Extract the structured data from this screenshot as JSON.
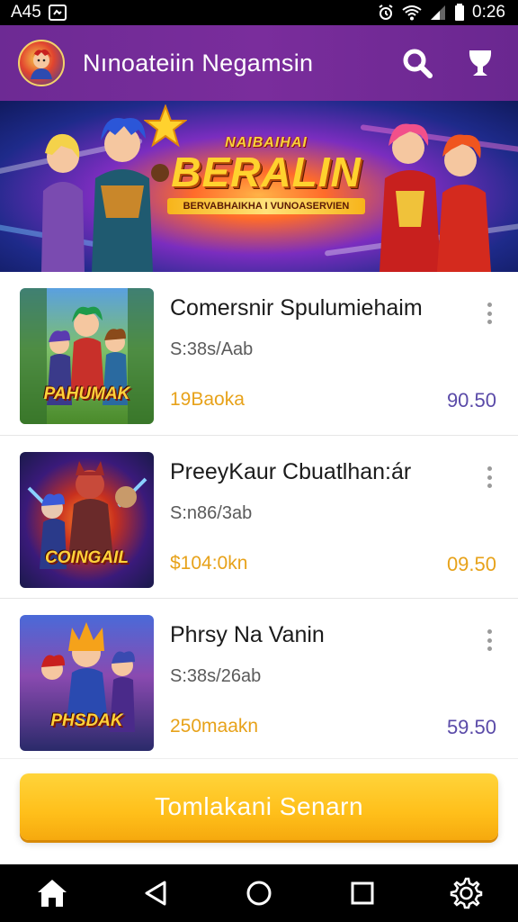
{
  "status_bar": {
    "left_text": "A45",
    "time": "0:26"
  },
  "header": {
    "title": "Nınoateiin  Negamsin",
    "search_icon": "search-icon",
    "trophy_icon": "trophy-icon"
  },
  "banner": {
    "subtitle": "NAIBAIHAI",
    "title": "BERALIN",
    "ribbon": "BERVABHAIKHA I VUNOASERVIEN"
  },
  "games": [
    {
      "name": "Comersnir Spulumiehaim",
      "sub": "S:38s/Aab",
      "price": "19Baoka",
      "rate": "90.50",
      "thumb_label": "PAHUMAK",
      "rate_color": "#5a4aa8"
    },
    {
      "name": "PreeyKaur Cbuatlhan:ár",
      "sub": "S:n86/3ab",
      "price": "$104:0kn",
      "rate": "09.50",
      "thumb_label": "COINGAIL",
      "rate_color": "#e7a21a"
    },
    {
      "name": "Phrsy Na Vanin",
      "sub": "S:38s/26ab",
      "price": "250maakn",
      "rate": "59.50",
      "thumb_label": "PHSDAK",
      "rate_color": "#5a4aa8"
    }
  ],
  "action": {
    "label": "Tomlakani Senarn"
  },
  "nav": {
    "home": "home-icon",
    "back": "back-icon",
    "home_circle": "home-circle-icon",
    "recents": "recents-icon",
    "settings": "settings-icon"
  }
}
